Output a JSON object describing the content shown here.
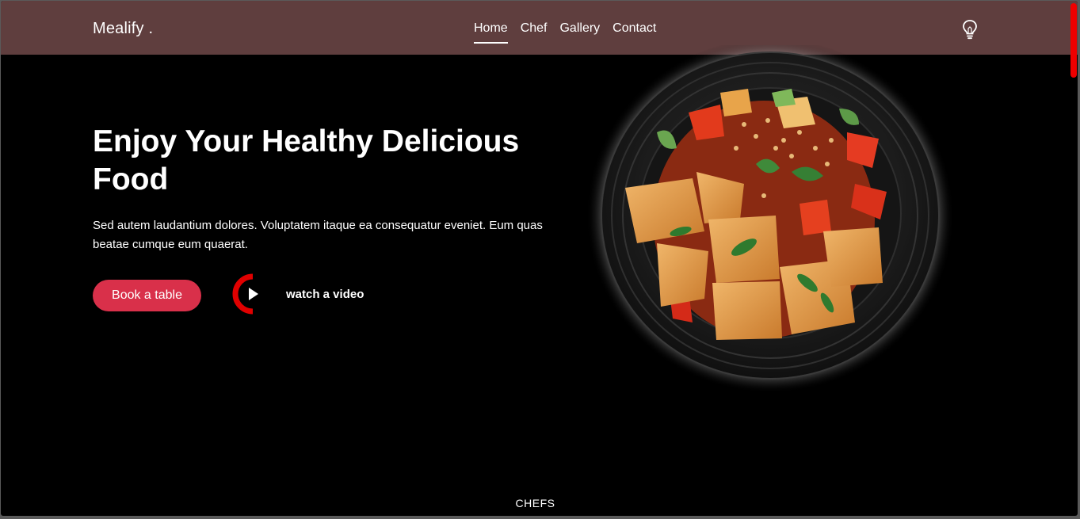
{
  "navbar": {
    "brand": "Mealify .",
    "links": [
      {
        "label": "Home",
        "active": true
      },
      {
        "label": "Chef",
        "active": false
      },
      {
        "label": "Gallery",
        "active": false
      },
      {
        "label": "Contact",
        "active": false
      }
    ],
    "theme_icon": "lightbulb-icon"
  },
  "hero": {
    "title": "Enjoy Your Healthy Delicious Food",
    "description": "Sed autem laudantium dolores. Voluptatem itaque ea consequatur eveniet. Eum quas beatae cumque eum quaerat.",
    "book_button": "Book a table",
    "video_label": "watch a video",
    "image": "food-plate-image"
  },
  "sections": {
    "chefs_label": "CHEFS"
  },
  "colors": {
    "navbar_bg": "#5f3e3e",
    "accent": "#d9304a",
    "ring": "#e00000",
    "page_bg": "#000000"
  }
}
